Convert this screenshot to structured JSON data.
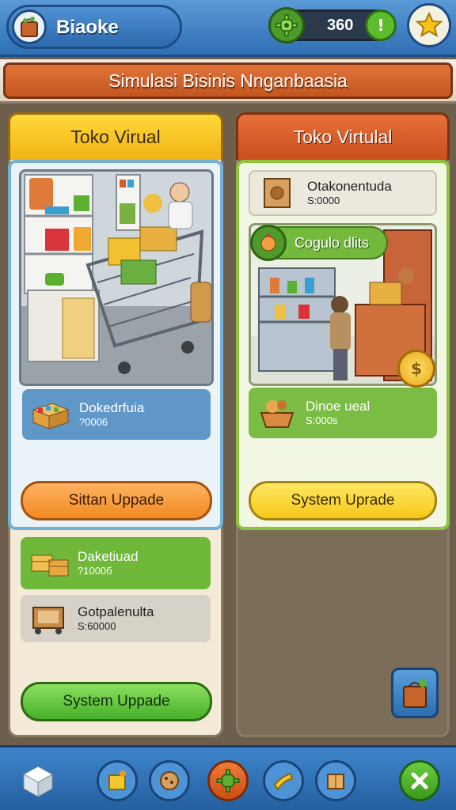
{
  "header": {
    "player_name": "Biaoke",
    "currency_value": "360",
    "add_label": "!"
  },
  "banner": {
    "title": "Simulasi Bisinis Nnganbaasia"
  },
  "left_panel": {
    "title": "Toko Virual",
    "items": [
      {
        "name": "Dokedrfuia",
        "price": "?0006"
      },
      {
        "name": "Daketiuad",
        "price": "?1000б"
      },
      {
        "name": "Gotpalenulta",
        "price": "S:60000"
      }
    ],
    "button_top": "Sittan Uppade",
    "button_bottom": "System Uppade"
  },
  "right_panel": {
    "title": "Toko Virtulal",
    "items": [
      {
        "name": "Otakonentuda",
        "price": "S:0000"
      },
      {
        "name": "Dinoe ueal",
        "price": "S:000s"
      }
    ],
    "chip_label": "Cogulo dlits",
    "coin_symbol": "$",
    "button": "System Uprade"
  },
  "icons": {
    "avatar": "shopping-bag-icon",
    "currency": "gear-icon",
    "favorite": "star-icon",
    "nav": [
      "cube-icon",
      "cheese-box-icon",
      "cookie-icon",
      "gear-icon",
      "horn-icon",
      "box-icon",
      "close-icon"
    ]
  },
  "colors": {
    "top_bar": "#3f85cc",
    "banner": "#c3561f",
    "left_header": "#f2b214",
    "right_header": "#c84f1c",
    "upgrade_orange": "#f08a22",
    "upgrade_yellow": "#f5c81a",
    "upgrade_green": "#47b02a"
  }
}
